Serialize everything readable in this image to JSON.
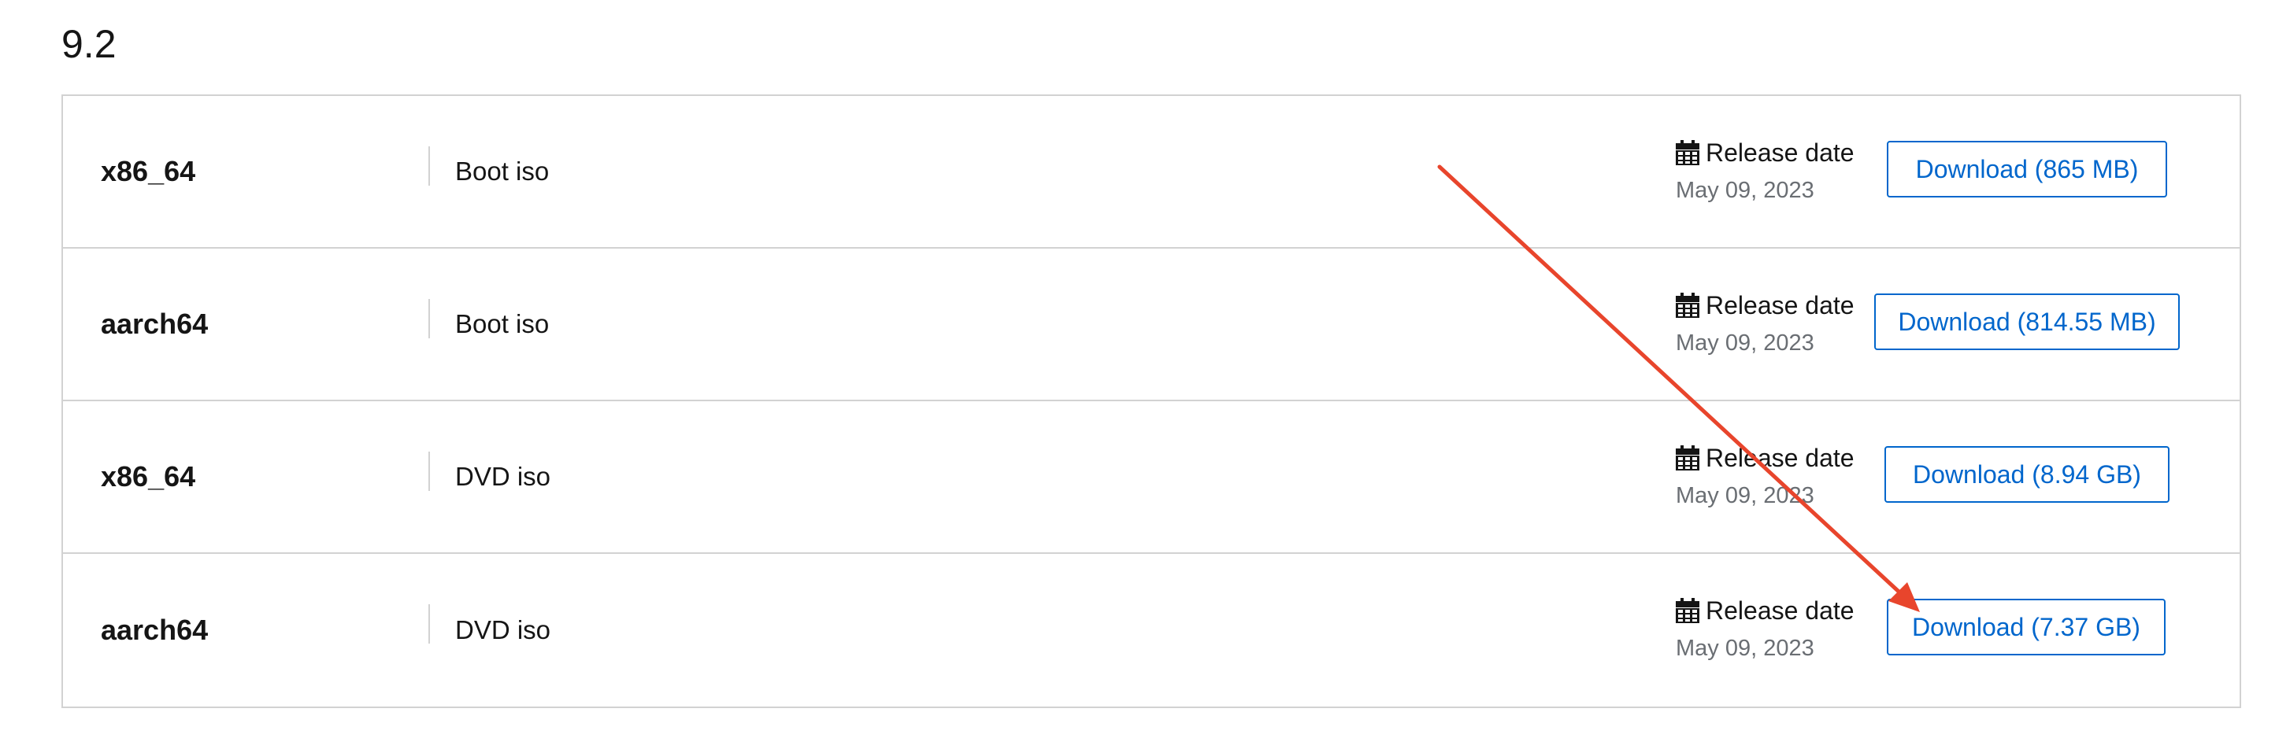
{
  "version": "9.2",
  "rows": [
    {
      "arch": "x86_64",
      "type": "Boot iso",
      "release_label": "Release date",
      "release_date": "May 09, 2023",
      "download_label": "Download (865 MB)"
    },
    {
      "arch": "aarch64",
      "type": "Boot iso",
      "release_label": "Release date",
      "release_date": "May 09, 2023",
      "download_label": "Download (814.55 MB)"
    },
    {
      "arch": "x86_64",
      "type": "DVD iso",
      "release_label": "Release date",
      "release_date": "May 09, 2023",
      "download_label": "Download (8.94 GB)"
    },
    {
      "arch": "aarch64",
      "type": "DVD iso",
      "release_label": "Release date",
      "release_date": "May 09, 2023",
      "download_label": "Download (7.37 GB)"
    }
  ],
  "icons": {
    "release": "calendar-icon",
    "annotation": "red-arrow-annotation"
  },
  "colors": {
    "link_blue": "#0066cc",
    "border_gray": "#d2d2d2",
    "muted_text": "#6a6e73",
    "annotation_red": "#e8452c"
  }
}
